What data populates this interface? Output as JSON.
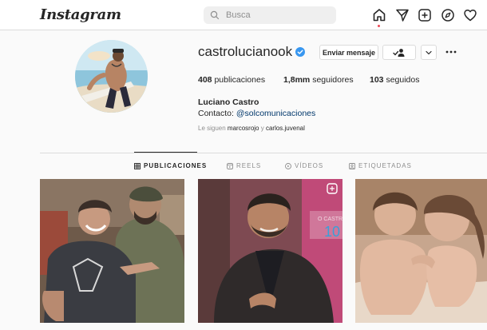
{
  "header": {
    "logo_text": "Instagram",
    "search_placeholder": "Busca",
    "nav_icons": [
      "home-icon",
      "direct-icon",
      "new-post-icon",
      "explore-icon",
      "activity-icon"
    ]
  },
  "profile": {
    "username": "castrolucianook",
    "verified": true,
    "message_button": "Enviar mensaje",
    "stats": {
      "posts_count": "408",
      "posts_label": "publicaciones",
      "followers_count": "1,8mm",
      "followers_label": "seguidores",
      "following_count": "103",
      "following_label": "seguidos"
    },
    "full_name": "Luciano Castro",
    "contact_label": "Contacto: ",
    "contact_handle": "@solcomunicaciones",
    "followed_by_prefix": "Le siguen ",
    "followed_by_user1": "marcosrojo",
    "followed_by_sep": " y ",
    "followed_by_user2": "carlos.juvenal"
  },
  "tabs": [
    {
      "label": "PUBLICACIONES",
      "active": true
    },
    {
      "label": "REELS",
      "active": false
    },
    {
      "label": "VÍDEOS",
      "active": false
    },
    {
      "label": "ETIQUETADAS",
      "active": false
    }
  ],
  "colors": {
    "link": "#00376b",
    "verified": "#3897f0",
    "notification_dot": "#ed4956",
    "muted": "#8e8e8e",
    "border": "#dbdbdb"
  }
}
